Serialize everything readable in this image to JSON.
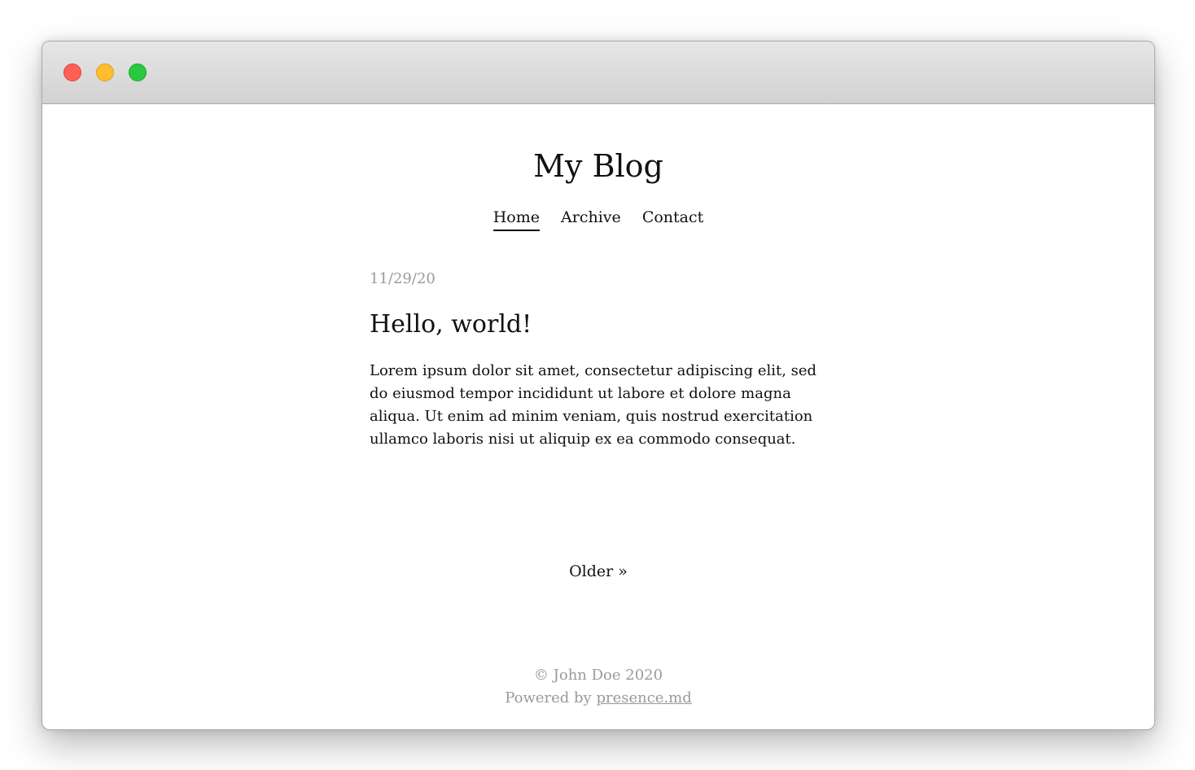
{
  "window": {
    "controls": [
      "close-button",
      "minimize-button",
      "zoom-button"
    ]
  },
  "site": {
    "title": "My Blog"
  },
  "nav": {
    "items": [
      {
        "label": "Home",
        "active": true
      },
      {
        "label": "Archive",
        "active": false
      },
      {
        "label": "Contact",
        "active": false
      }
    ]
  },
  "post": {
    "date": "11/29/20",
    "title": "Hello, world!",
    "body": "Lorem ipsum dolor sit amet, consectetur adipiscing elit, sed do eiusmod tempor incididunt ut labore et dolore magna aliqua. Ut enim ad minim veniam, quis nostrud exercitation ullamco laboris nisi ut aliquip ex ea commodo consequat."
  },
  "pagination": {
    "older_label": "Older »"
  },
  "footer": {
    "copyright": "© John Doe 2020",
    "powered_prefix": "Powered by ",
    "powered_link": "presence.md"
  },
  "colors": {
    "close": "#fe5f57",
    "minimize": "#febc2e",
    "zoom": "#28c840",
    "muted_text": "#9a9a9a",
    "text": "#111111"
  }
}
